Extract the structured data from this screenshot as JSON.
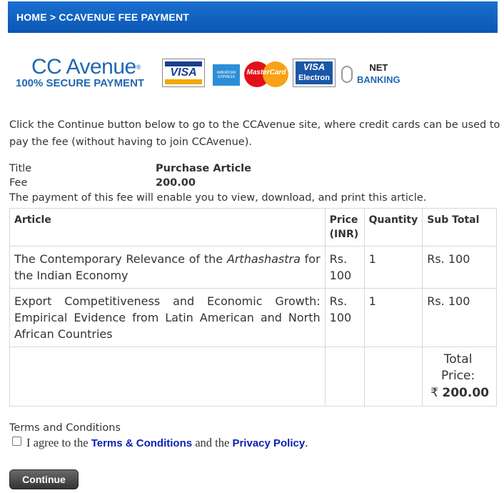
{
  "breadcrumb": {
    "text": "HOME > CCAVENUE FEE PAYMENT"
  },
  "logo": {
    "brand": "CC Avenue",
    "trademark": "®",
    "tagline": "100% SECURE PAYMENT",
    "cards": {
      "visa": "VISA",
      "amex": "AMERICAN EXPRESS",
      "mastercard": "MasterCard",
      "visa_electron_top": "VISA",
      "visa_electron_bottom": "Electron",
      "net_top": "NET",
      "net_bottom": "BANKING"
    }
  },
  "intro": "Click the Continue button below to go to the CCAvenue site, where credit cards can be used to pay the fee (without having to join CCAvenue).",
  "meta": {
    "title_label": "Title",
    "title_value": "Purchase Article",
    "fee_label": "Fee",
    "fee_value": "200.00",
    "note": "The payment of this fee will enable you to view, download, and print this article."
  },
  "table": {
    "headers": {
      "article": "Article",
      "price": "Price (INR)",
      "quantity": "Quantity",
      "subtotal": "Sub Total"
    },
    "rows": [
      {
        "article_prefix": "The Contemporary Relevance of the ",
        "article_em": "Arthashastra",
        "article_suffix": " for the Indian Economy",
        "price": "Rs. 100",
        "quantity": "1",
        "subtotal": "Rs. 100"
      },
      {
        "article_prefix": "Export Competitiveness and Economic Growth: Empirical Evidence from Latin American and North African Countries",
        "article_em": "",
        "article_suffix": "",
        "price": "Rs. 100",
        "quantity": "1",
        "subtotal": "Rs. 100"
      }
    ],
    "total_label": "Total Price:",
    "currency_symbol": "₹",
    "total_value": "200.00"
  },
  "terms": {
    "heading": "Terms and Conditions",
    "agree_prefix": "I agree to the ",
    "terms_link": "Terms & Conditions",
    "and_text": " and the ",
    "privacy_link": "Privacy Policy",
    "suffix": "."
  },
  "continue_label": "Continue",
  "colors": {
    "brand_blue": "#1f67b1",
    "bar_blue": "#0b56b3",
    "link_blue": "#0a1fb5"
  }
}
